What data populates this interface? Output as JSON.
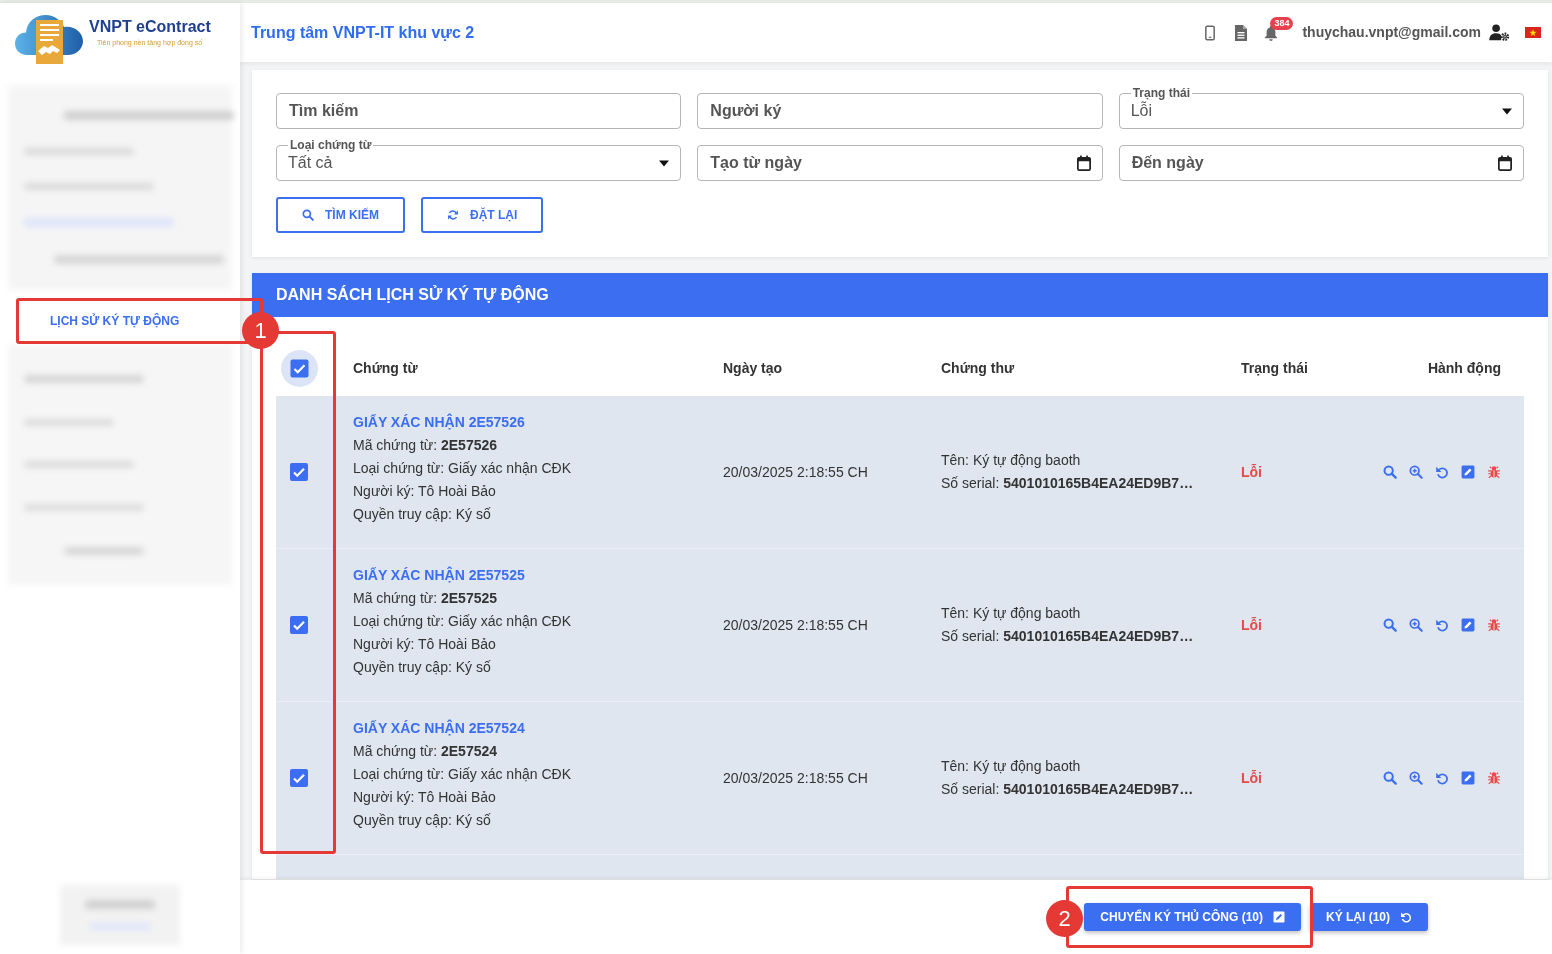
{
  "header": {
    "brand": "VNPT eContract",
    "tagline": "Tiên phong nền tảng hợp đồng số",
    "org_title": "Trung tâm VNPT-IT khu vực 2",
    "notification_count": "384",
    "user_email": "thuychau.vnpt@gmail.com"
  },
  "sidebar": {
    "blurred": true,
    "items": [
      {
        "label": "LỊCH SỬ KÝ TỰ ĐỘNG",
        "selected": true
      }
    ]
  },
  "filters": {
    "fields": [
      {
        "kind": "text",
        "placeholder": "Tìm kiếm"
      },
      {
        "kind": "text",
        "placeholder": "Người ký"
      },
      {
        "kind": "select",
        "label": "Trạng thái",
        "value": "Lỗi"
      },
      {
        "kind": "select",
        "label": "Loại chứng từ",
        "value": "Tất cả"
      },
      {
        "kind": "date",
        "placeholder": "Tạo từ ngày"
      },
      {
        "kind": "date",
        "placeholder": "Đến ngày"
      }
    ],
    "buttons": [
      {
        "kind": "search",
        "label": "TÌM KIẾM"
      },
      {
        "kind": "reset",
        "label": "ĐẶT LẠI"
      }
    ]
  },
  "table": {
    "title": "DANH SÁCH LỊCH SỬ KÝ TỰ ĐỘNG",
    "select_all": {
      "checked": true
    },
    "columns": [
      "Chứng từ",
      "Ngày tạo",
      "Chứng thư",
      "Trạng thái",
      "Hành động"
    ],
    "rows": [
      {
        "checked": true,
        "title": "GIẤY XÁC NHẬN 2E57526",
        "details": [
          "Mã chứng từ: **2E57526**",
          "Loại chứng từ: Giấy xác nhận CĐK",
          "Người ký: Tô Hoài Bảo",
          "Quyền truy cập: Ký số"
        ],
        "created": "20/03/2025 2:18:55 CH",
        "certificate": [
          "Tên: Ký tự động baoth",
          "Số serial: **5401010165B4EA24ED9B7…**"
        ],
        "status": {
          "label": "Lỗi",
          "kind": "error"
        }
      },
      {
        "checked": true,
        "title": "GIẤY XÁC NHẬN 2E57525",
        "details": [
          "Mã chứng từ: **2E57525**",
          "Loại chứng từ: Giấy xác nhận CĐK",
          "Người ký: Tô Hoài Bảo",
          "Quyền truy cập: Ký số"
        ],
        "created": "20/03/2025 2:18:55 CH",
        "certificate": [
          "Tên: Ký tự động baoth",
          "Số serial: **5401010165B4EA24ED9B7…**"
        ],
        "status": {
          "label": "Lỗi",
          "kind": "error"
        }
      },
      {
        "checked": true,
        "title": "GIẤY XÁC NHẬN 2E57524",
        "details": [
          "Mã chứng từ: **2E57524**",
          "Loại chứng từ: Giấy xác nhận CĐK",
          "Người ký: Tô Hoài Bảo",
          "Quyền truy cập: Ký số"
        ],
        "created": "20/03/2025 2:18:55 CH",
        "certificate": [
          "Tên: Ký tự động baoth",
          "Số serial: **5401010165B4EA24ED9B7…**"
        ],
        "status": {
          "label": "Lỗi",
          "kind": "error"
        }
      }
    ],
    "more_rows": true
  },
  "footer": {
    "buttons": [
      {
        "kind": "manual",
        "label": "CHUYỂN KÝ THỦ CÔNG (10)"
      },
      {
        "kind": "resign",
        "label": "KÝ LẠI (10)"
      }
    ]
  },
  "annotations": [
    {
      "number": "1"
    },
    {
      "number": "2"
    }
  ]
}
